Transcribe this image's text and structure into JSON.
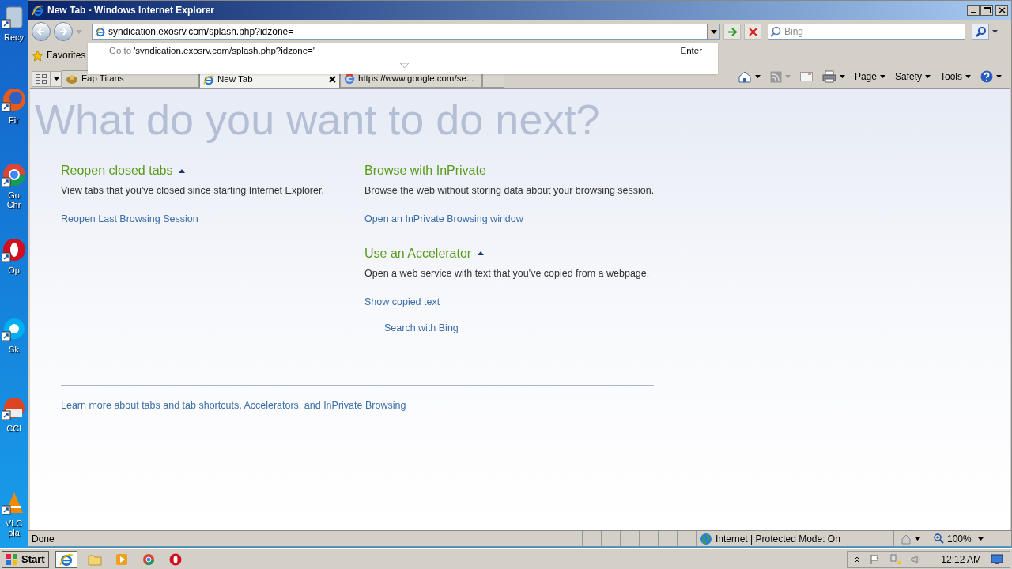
{
  "desktop_icons": [
    {
      "label": "Recy",
      "kind": "bin"
    },
    {
      "label": "Fir",
      "kind": "firefox"
    },
    {
      "label": "Go Chr",
      "kind": "chrome"
    },
    {
      "label": "Op",
      "kind": "opera"
    },
    {
      "label": "Sk",
      "kind": "skype"
    },
    {
      "label": "CCl",
      "kind": "ccleaner"
    },
    {
      "label": "VLC pla",
      "kind": "vlc"
    }
  ],
  "window": {
    "title": "New Tab - Windows Internet Explorer"
  },
  "address_bar": {
    "value": "syndication.exosrv.com/splash.php?idzone="
  },
  "suggestion": {
    "prefix": "Go to",
    "text": "'syndication.exosrv.com/splash.php?idzone='",
    "hint": "Enter"
  },
  "search": {
    "placeholder": "Bing"
  },
  "favorites": {
    "label": "Favorites"
  },
  "tabs": [
    {
      "label": "Fap Titans",
      "selected": false,
      "kind": "game"
    },
    {
      "label": "New Tab",
      "selected": true,
      "kind": "ie"
    },
    {
      "label": "https://www.google.com/se...",
      "selected": false,
      "kind": "google"
    }
  ],
  "command_bar": [
    "Page",
    "Safety",
    "Tools"
  ],
  "page": {
    "heading": "What do you want to do next?",
    "left": [
      {
        "title": "Reopen closed tabs",
        "expanded": true,
        "description": "View tabs that you've closed since starting Internet Explorer.",
        "links": [
          {
            "label": "Reopen Last Browsing Session"
          }
        ]
      }
    ],
    "right": [
      {
        "title": "Browse with InPrivate",
        "description": "Browse the web without storing data about your browsing session.",
        "links": [
          {
            "label": "Open an InPrivate Browsing window"
          }
        ]
      },
      {
        "title": "Use an Accelerator",
        "expanded": true,
        "description": "Open a web service with text that you've copied from a webpage.",
        "links": [
          {
            "label": "Show copied text",
            "children": [
              {
                "label": "Search with Bing"
              }
            ]
          }
        ]
      }
    ],
    "footer_link": "Learn more about tabs and tab shortcuts, Accelerators, and InPrivate Browsing"
  },
  "status_bar": {
    "text": "Done",
    "zone": "Internet | Protected Mode: On",
    "zoom": "100%"
  },
  "taskbar": {
    "start": "Start",
    "apps": [
      {
        "kind": "ie",
        "selected": true
      },
      {
        "kind": "folder",
        "selected": false
      },
      {
        "kind": "media",
        "selected": false
      },
      {
        "kind": "chrome",
        "selected": false
      },
      {
        "kind": "opera",
        "selected": false
      }
    ],
    "clock": "12:12 AM"
  }
}
